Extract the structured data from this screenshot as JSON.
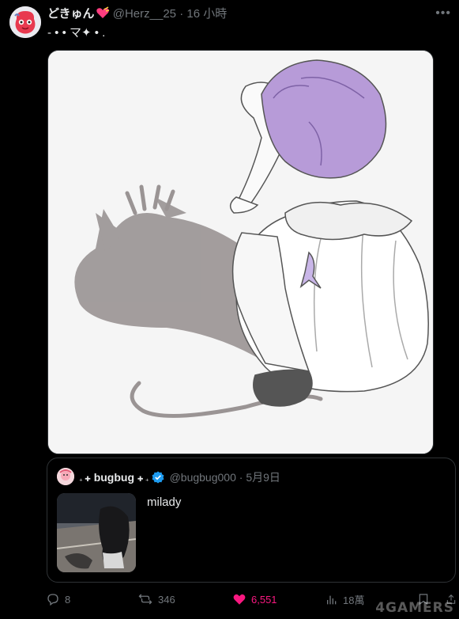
{
  "post": {
    "display_name": "どきゅん",
    "handle": "@Herz__25",
    "separator": "·",
    "time": "16 小時",
    "text": "- • • マ✦ • .",
    "more_label": "•••",
    "heart_emoji": "heart-with-ribbon-icon"
  },
  "quote": {
    "name_prefix": "₊ ✚",
    "name": "bugbug",
    "name_suffix": "✚ ₊",
    "handle": "@bugbug000",
    "separator": "·",
    "date": "5月9日",
    "text": "milady",
    "verified_color": "#1d9bf0"
  },
  "actions": {
    "reply_count": "8",
    "repost_count": "346",
    "like_count": "6,551",
    "views_count": "18萬"
  },
  "colors": {
    "like": "#f91880",
    "muted": "#71767b",
    "border": "#2f3336"
  },
  "watermark": "4GAMERS"
}
